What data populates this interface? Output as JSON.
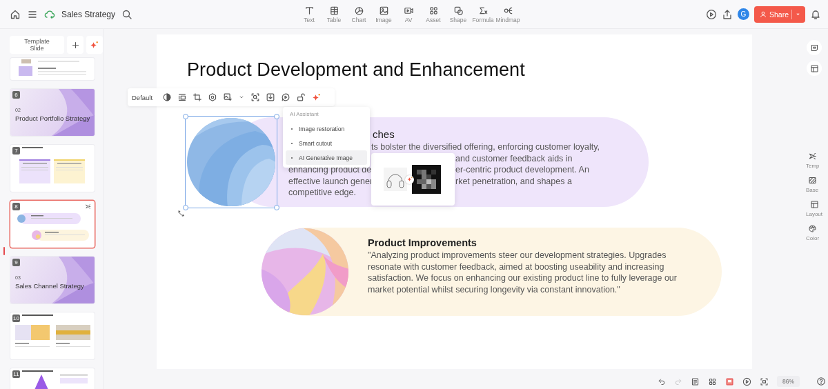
{
  "header": {
    "document_title": "Sales Strategy",
    "tools": [
      {
        "label": "Text"
      },
      {
        "label": "Table"
      },
      {
        "label": "Chart"
      },
      {
        "label": "Image"
      },
      {
        "label": "AV"
      },
      {
        "label": "Asset"
      },
      {
        "label": "Shape"
      },
      {
        "label": "Formula"
      },
      {
        "label": "Mindmap"
      }
    ],
    "avatar": {
      "initial": "G"
    },
    "share_button": {
      "label": "Share"
    }
  },
  "sidebar": {
    "template_button": {
      "label": "Template Slide"
    },
    "slides": [
      {
        "kind": "partial",
        "selected": false
      },
      {
        "kind": "section",
        "number": "6",
        "section": "02",
        "title": "Product Portfolio Strategy",
        "selected": false
      },
      {
        "kind": "columns",
        "number": "7",
        "selected": false
      },
      {
        "kind": "cards",
        "number": "8",
        "selected": true
      },
      {
        "kind": "section",
        "number": "9",
        "section": "03",
        "title": "Sales Channel Strategy",
        "selected": false
      },
      {
        "kind": "images",
        "number": "10",
        "selected": false
      },
      {
        "kind": "triangle",
        "number": "11",
        "selected": false
      }
    ]
  },
  "slide": {
    "title": "Product Development and Enhancement",
    "cards": [
      {
        "kind": "covered",
        "heading": "ches",
        "lines": [
          {
            "kind": "after_menu",
            "right": "ts bolster the diversified offering, enforcing customer loyalty,"
          },
          {
            "kind": "after_popup",
            "right": "and customer feedback aids in"
          },
          {
            "kind": "split",
            "left": "enhancing product de",
            "right": "er-centric product development. An"
          },
          {
            "kind": "split",
            "left": "effective launch gener",
            "right": "rket penetration, and shapes a"
          },
          {
            "kind": "full",
            "left": "competitive edge."
          }
        ]
      },
      {
        "kind": "plain",
        "heading": "Product Improvements",
        "body": "\"Analyzing product improvements steer our development strategies. Upgrades resonate with customer feedback, aimed at boosting useability and increasing satisfaction. We focus on enhancing our existing product line to fully leverage our market potential whilst securing longevity via constant innovation.\""
      }
    ]
  },
  "image_toolbar": {
    "style_label": "Default"
  },
  "ai_menu": {
    "title": "AI Assistant",
    "items": [
      {
        "label": "Image restoration",
        "selected": false
      },
      {
        "label": "Smart cutout",
        "selected": false
      },
      {
        "label": "AI Generative Image",
        "selected": true
      }
    ]
  },
  "right_panel": {
    "tools": [
      {
        "label": "Temp"
      },
      {
        "label": "Base"
      },
      {
        "label": "Layout"
      },
      {
        "label": "Color"
      }
    ]
  },
  "status_bar": {
    "history": [
      {
        "kind": "undo",
        "disabled": false
      },
      {
        "kind": "redo",
        "disabled": true
      }
    ],
    "zoom": "86%"
  }
}
